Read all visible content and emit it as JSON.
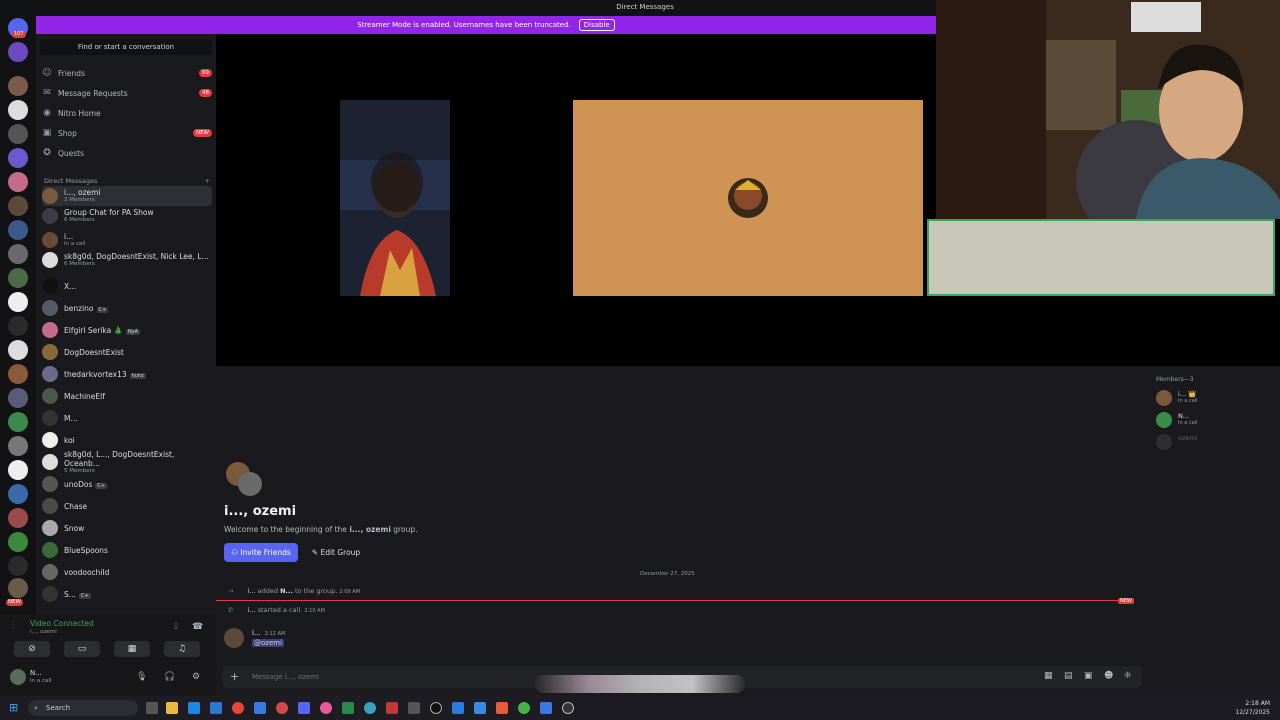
{
  "topbar": {
    "title": "Direct Messages"
  },
  "streamer_banner": {
    "text": "Streamer Mode is enabled. Usernames have been truncated.",
    "button": "Disable"
  },
  "server_rail": {
    "home_badge": "107",
    "new_badge": "NEW"
  },
  "sidebar": {
    "find_placeholder": "Find or start a conversation",
    "nav": [
      {
        "label": "Friends",
        "icon": "friends-icon",
        "count": "69"
      },
      {
        "label": "Message Requests",
        "icon": "mail-icon",
        "count": "48"
      },
      {
        "label": "Nitro Home",
        "icon": "nitro-icon",
        "count": ""
      },
      {
        "label": "Shop",
        "icon": "shop-icon",
        "count": "NEW"
      },
      {
        "label": "Quests",
        "icon": "quests-icon",
        "count": ""
      }
    ],
    "dm_header": "Direct Messages",
    "dms": [
      {
        "name": "i..., ozemi",
        "sub": "3 Members",
        "color": "#7a5a3a"
      },
      {
        "name": "Group Chat for PA Show",
        "sub": "6 Members",
        "color": "#3a3d45"
      },
      {
        "name": "i...",
        "sub": "In a call",
        "color": "#6b4a32"
      },
      {
        "name": "sk8g0d, DogDoesntExist, Nick Lee, L...",
        "sub": "6 Members",
        "color": "#ddd"
      },
      {
        "name": "X...",
        "sub": "",
        "color": "#111"
      },
      {
        "name": "benzino",
        "sub": "",
        "color": "#555a66",
        "tag": "C+"
      },
      {
        "name": "Elfgirl Serika 🎄",
        "sub": "",
        "color": "#c46b8a",
        "tag": "NyA"
      },
      {
        "name": "DogDoesntExist",
        "sub": "",
        "color": "#8a6a3a"
      },
      {
        "name": "thedarkvortex13",
        "sub": "",
        "color": "#6a6a8a",
        "tag": "hunz"
      },
      {
        "name": "MachineElf",
        "sub": "",
        "color": "#4a5a4a"
      },
      {
        "name": "M...",
        "sub": "",
        "color": "#333"
      },
      {
        "name": "koi",
        "sub": "",
        "color": "#eee"
      },
      {
        "name": "sk8g0d, L..., DogDoesntExist, Oceanb...",
        "sub": "5 Members",
        "color": "#ddd"
      },
      {
        "name": "unoDos",
        "sub": "",
        "color": "#555",
        "tag": "C+"
      },
      {
        "name": "Chase",
        "sub": "",
        "color": "#4a4a4a"
      },
      {
        "name": "Snow",
        "sub": "",
        "color": "#aaa"
      },
      {
        "name": "BlueSpoons",
        "sub": "",
        "color": "#3a6a3a"
      },
      {
        "name": "voodoochild",
        "sub": "",
        "color": "#666"
      },
      {
        "name": "S...",
        "sub": "",
        "color": "#333",
        "tag": "C+"
      }
    ]
  },
  "voice": {
    "status": "Video Connected",
    "channel": "i..., ozemi"
  },
  "user": {
    "name": "N...",
    "status": "In a call"
  },
  "chat": {
    "group_title": "i..., ozemi",
    "welcome_prefix": "Welcome to the beginning of the",
    "welcome_group": "i..., ozemi",
    "welcome_suffix": "group.",
    "invite_label": "Invite Friends",
    "edit_label": "Edit Group",
    "date": "December 27, 2025",
    "new_tag": "NEW",
    "sys1_user": "i...",
    "sys1_text": "added",
    "sys1_target": "N...",
    "sys1_tail": "to the group.",
    "sys1_time": "2:09 AM",
    "sys2_user": "i...",
    "sys2_text": "started a call.",
    "sys2_time": "2:10 AM",
    "msg_user": "i...",
    "msg_time": "2:12 AM",
    "msg_mention": "@ozemi",
    "composer_placeholder": "Message i..., ozemi"
  },
  "members": {
    "title": "Members—3",
    "list": [
      {
        "name": "i... 👑",
        "sub": "In a call",
        "color": "#7a5a3a"
      },
      {
        "name": "N...",
        "sub": "In a call",
        "color": "#3a8a4a"
      },
      {
        "name": "ozemi",
        "sub": "",
        "color": "#444"
      }
    ]
  },
  "taskbar": {
    "search": "Search",
    "time": "2:18 AM",
    "date": "12/27/2025"
  }
}
